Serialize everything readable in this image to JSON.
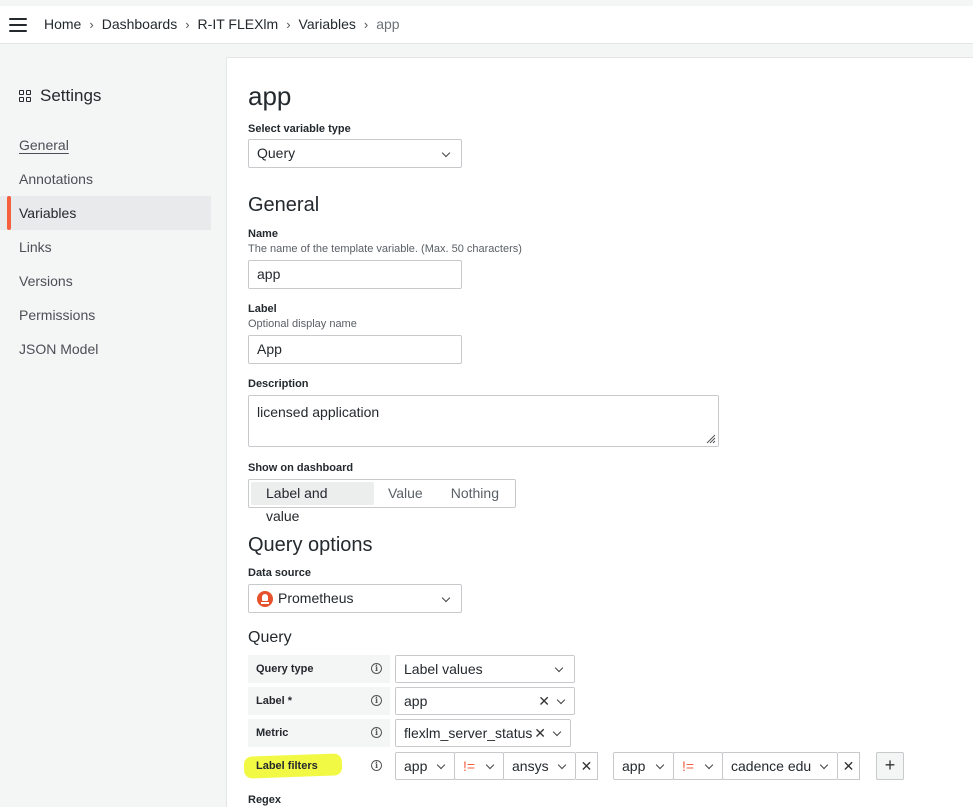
{
  "breadcrumb": [
    "Home",
    "Dashboards",
    "R-IT FLEXlm",
    "Variables",
    "app"
  ],
  "sidebar": {
    "title": "Settings",
    "items": [
      {
        "label": "General"
      },
      {
        "label": "Annotations"
      },
      {
        "label": "Variables"
      },
      {
        "label": "Links"
      },
      {
        "label": "Versions"
      },
      {
        "label": "Permissions"
      },
      {
        "label": "JSON Model"
      }
    ]
  },
  "page": {
    "title": "app",
    "variable_type_label": "Select variable type",
    "variable_type_value": "Query",
    "general_heading": "General",
    "name_label": "Name",
    "name_desc": "The name of the template variable. (Max. 50 characters)",
    "name_value": "app",
    "label_label": "Label",
    "label_desc": "Optional display name",
    "label_value": "App",
    "description_label": "Description",
    "description_value": "licensed application",
    "show_label": "Show on dashboard",
    "show_options": [
      "Label and value",
      "Value",
      "Nothing"
    ],
    "query_options_heading": "Query options",
    "datasource_label": "Data source",
    "datasource_value": "Prometheus",
    "query_heading": "Query",
    "query_type_label": "Query type",
    "query_type_value": "Label values",
    "label_field_label": "Label *",
    "label_field_value": "app",
    "metric_label": "Metric",
    "metric_value": "flexlm_server_status",
    "label_filters_label": "Label filters",
    "filters": [
      {
        "key": "app",
        "op": "!=",
        "value": "ansys"
      },
      {
        "key": "app",
        "op": "!=",
        "value": "cadence edu"
      }
    ],
    "add_label": "+",
    "regex_label": "Regex"
  },
  "colors": {
    "accent": "#f55f3e",
    "highlight": "#f1f93a"
  }
}
